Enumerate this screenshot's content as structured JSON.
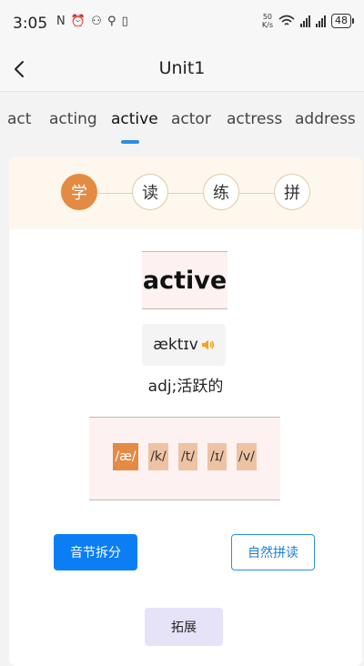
{
  "status": {
    "time": "3:05",
    "left_icons_text": "N ⏰ ⚇ ⚲ ▯",
    "netspeed_value": "50",
    "netspeed_unit": "K/s",
    "battery": "48"
  },
  "header": {
    "title": "Unit1"
  },
  "tabs": [
    "act",
    "acting",
    "active",
    "actor",
    "actress",
    "address"
  ],
  "active_tab": "active",
  "steps": [
    "学",
    "读",
    "练",
    "拼"
  ],
  "word": {
    "text": "active",
    "phonetic": "æktɪv",
    "meaning": "adj;活跃的"
  },
  "syllables": [
    "/æ/",
    "/k/",
    "/t/",
    "/ɪ/",
    "/v/"
  ],
  "buttons": {
    "syllable_split": "音节拆分",
    "natural_phonics": "自然拼读",
    "expand": "拓展"
  },
  "icons": {
    "back": "chevron-left-icon",
    "speaker": "speaker-icon"
  },
  "colors": {
    "accent_orange": "#e48a42",
    "primary_blue": "#0b7ef6",
    "tab_indicator": "#2b8ee6"
  }
}
